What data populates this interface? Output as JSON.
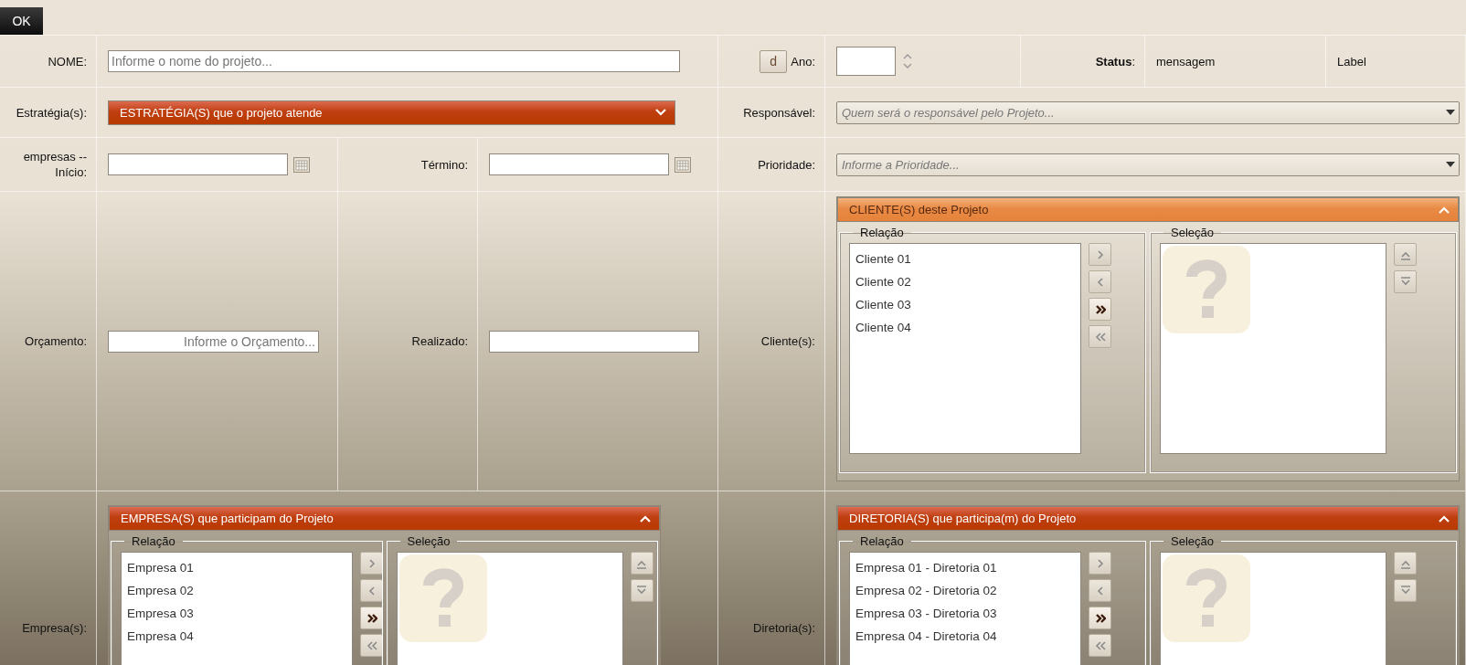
{
  "ok_button": "OK",
  "nome": {
    "label": "NOME:",
    "placeholder": "Informe o nome do projeto..."
  },
  "ano": {
    "button": "d",
    "label": "Ano:"
  },
  "status": {
    "label": "**Status**:",
    "message": "mensagem",
    "extra_label": "Label"
  },
  "estrategias": {
    "label": "Estratégia(s):",
    "title": "ESTRATÉGIA(S) que o projeto atende",
    "expanded": false
  },
  "responsavel": {
    "label": "Responsável:",
    "placeholder": "Quem será o responsável pelo Projeto..."
  },
  "inicio": {
    "label": "empresas  --  Início:"
  },
  "termino": {
    "label": "Término:"
  },
  "prioridade": {
    "label": "Prioridade:",
    "placeholder": "Informe a Prioridade..."
  },
  "orcamento": {
    "label": "Orçamento:",
    "placeholder": "Informe o Orçamento..."
  },
  "realizado": {
    "label": "Realizado:"
  },
  "clientes": {
    "label": "Cliente(s):",
    "title": "CLIENTE(S) deste Projeto",
    "expanded": true,
    "highlighted": true,
    "relation": {
      "title": "Relação",
      "items": [
        "Cliente 01",
        "Cliente 02",
        "Cliente 03",
        "Cliente 04"
      ]
    },
    "selection": {
      "title": "Seleção",
      "empty": true
    },
    "transfer_buttons": [
      {
        "kind": "add",
        "disabled": true
      },
      {
        "kind": "remove",
        "disabled": true
      },
      {
        "kind": "add-all",
        "disabled": false
      },
      {
        "kind": "remove-all",
        "disabled": true
      }
    ],
    "order_buttons": [
      {
        "kind": "up",
        "disabled": true
      },
      {
        "kind": "down",
        "disabled": true
      }
    ]
  },
  "empresas": {
    "label": "Empresa(s):",
    "title": "EMPRESA(S) que participam do Projeto",
    "expanded": true,
    "highlighted": false,
    "relation": {
      "title": "Relação",
      "items": [
        "Empresa 01",
        "Empresa 02",
        "Empresa 03",
        "Empresa 04"
      ]
    },
    "selection": {
      "title": "Seleção",
      "empty": true
    },
    "transfer_buttons": [
      {
        "kind": "add",
        "disabled": true
      },
      {
        "kind": "remove",
        "disabled": true
      },
      {
        "kind": "add-all",
        "disabled": false
      },
      {
        "kind": "remove-all",
        "disabled": true
      }
    ],
    "order_buttons": [
      {
        "kind": "up",
        "disabled": true
      },
      {
        "kind": "down",
        "disabled": true
      }
    ]
  },
  "diretorias": {
    "label": "Diretoria(s):",
    "title": "DIRETORIA(S) que participa(m) do Projeto",
    "expanded": true,
    "highlighted": false,
    "relation": {
      "title": "Relação",
      "items": [
        "Empresa 01  -  Diretoria 01",
        "Empresa 02  -  Diretoria 02",
        "Empresa 03  -  Diretoria 03",
        "Empresa 04  -  Diretoria 04"
      ]
    },
    "selection": {
      "title": "Seleção",
      "empty": true
    },
    "transfer_buttons": [
      {
        "kind": "add",
        "disabled": true
      },
      {
        "kind": "remove",
        "disabled": true
      },
      {
        "kind": "add-all",
        "disabled": false
      },
      {
        "kind": "remove-all",
        "disabled": true
      }
    ],
    "order_buttons": [
      {
        "kind": "up",
        "disabled": true
      },
      {
        "kind": "down",
        "disabled": true
      }
    ]
  }
}
